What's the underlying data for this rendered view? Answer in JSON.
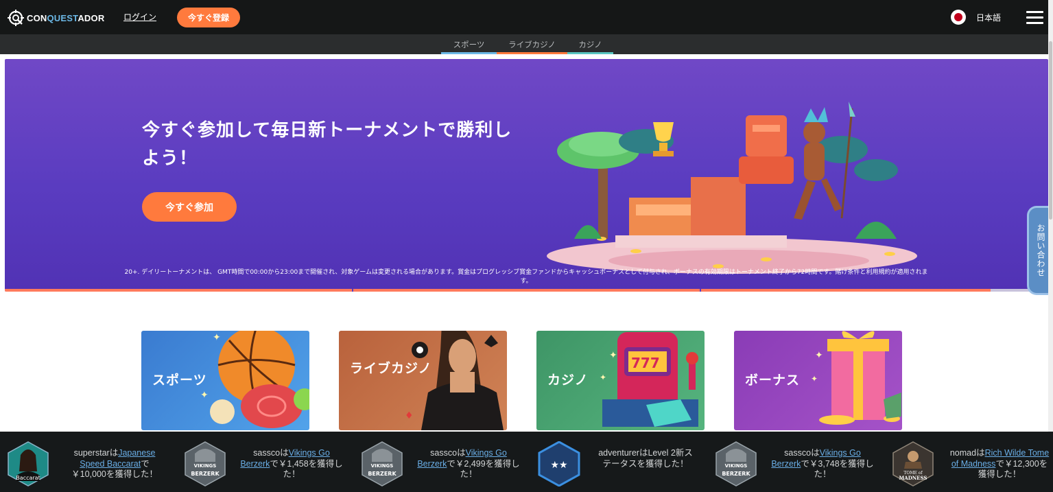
{
  "header": {
    "brand_prefix": "CON",
    "brand_q": "QUEST",
    "brand_suffix": "ADOR",
    "login_label": "ログイン",
    "register_label": "今すぐ登録",
    "language_label": "日本語",
    "accent_color": "#ff7a3d"
  },
  "subnav": {
    "tabs": [
      {
        "label": "スポーツ",
        "color": "#6cb8e6"
      },
      {
        "label": "ライブカジノ",
        "color": "#ff7a3d"
      },
      {
        "label": "カジノ",
        "color": "#59c6c0"
      }
    ]
  },
  "hero": {
    "title": "今すぐ参加して毎日新トーナメントで勝利しよう！",
    "cta_label": "今すぐ参加",
    "disclaimer": "20+. デイリートーナメントは、 GMT時間で00:00から23:00まで開催され、対象ゲームは変更される場合があります。賞金はプログレッシブ賞金ファンドからキャッシュボーナスとして付与され、ボーナスの有効期限はトーナメント終了から72時間です。賭け条件と利用規約が適用されます。",
    "slide_progress": 0.945
  },
  "contact_tab": {
    "label": "お問い合わせ"
  },
  "categories": [
    {
      "label": "スポーツ",
      "color": "#3f8bd8"
    },
    {
      "label": "ライブカジノ",
      "color": "#c2704a"
    },
    {
      "label": "カジノ",
      "color": "#3f9a68"
    },
    {
      "label": "ボーナス",
      "color": "#8c44b8"
    }
  ],
  "ticker": {
    "wins": [
      {
        "user": "superstar",
        "connector": "は",
        "game": "Japanese Speed Baccarat",
        "tail": "で￥10,000を獲得した！",
        "icon": "baccarat-dealer-icon"
      },
      {
        "user": "sassco",
        "connector": "は",
        "game": "Vikings Go Berzerk",
        "tail": "で￥1,458を獲得した！",
        "icon": "vikings-go-berzerk-icon"
      },
      {
        "user": "sassco",
        "connector": "は",
        "game": "Vikings Go Berzerk",
        "tail": "で￥2,499を獲得した！",
        "icon": "vikings-go-berzerk-icon"
      },
      {
        "user": "adventurer",
        "connector": "は",
        "game": "",
        "tail": "Level 2新ステータスを獲得した！",
        "icon": "level-star-badge-icon"
      },
      {
        "user": "sassco",
        "connector": "は",
        "game": "Vikings Go Berzerk",
        "tail": "で￥3,748を獲得した！",
        "icon": "vikings-go-berzerk-icon"
      },
      {
        "user": "nomad",
        "connector": "は",
        "game": "Rich Wilde Tome of Madness",
        "tail": "で￥12,300を獲得した！",
        "icon": "tome-of-madness-icon"
      }
    ],
    "vikings_logo_top": "VIKINGS",
    "vikings_logo_bottom": "BERZERK",
    "tome_logo_top": "TOME of",
    "tome_logo_bottom": "MADNESS",
    "baccarat_logo": "Baccarat"
  }
}
